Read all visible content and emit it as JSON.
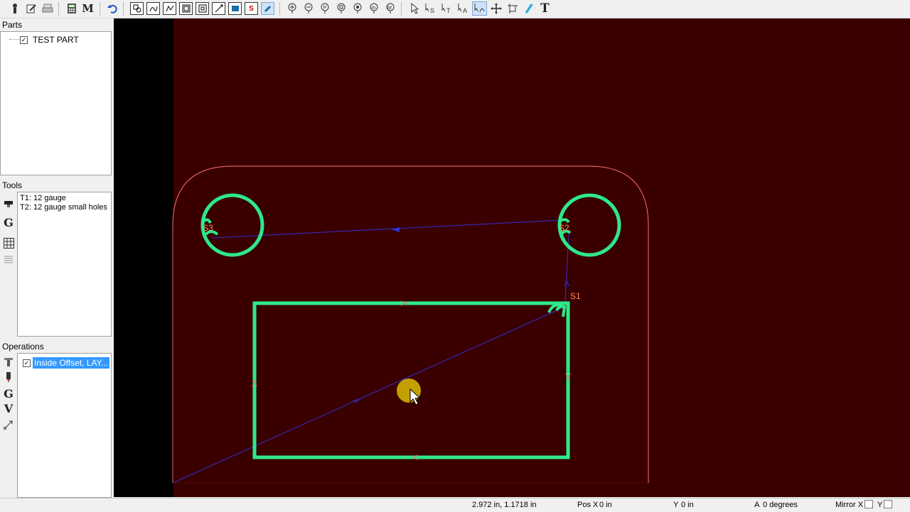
{
  "toolbar": {
    "icons": [
      "setup-icon",
      "edit-icon",
      "print-icon",
      "calculator-icon",
      "macro-icon",
      "undo-icon",
      "geometry-icon",
      "curve-icon",
      "path-icon",
      "offset-icon",
      "nested-offset-icon",
      "line-icon",
      "screen-icon",
      "s-icon",
      "brush-icon",
      "zoom-in-icon",
      "zoom-out-icon",
      "zoom-part-icon",
      "zoom-window-icon",
      "zoom-all-icon",
      "zoom-extents-icon",
      "select-icon",
      "select-s-icon",
      "select-t-icon",
      "select-a-icon",
      "select-curve-icon",
      "move-icon",
      "rotate-icon",
      "magnet-icon",
      "text-icon"
    ],
    "macro_label": "M",
    "text_label": "T",
    "s_label": "S"
  },
  "parts": {
    "title": "Parts",
    "items": [
      {
        "label": "TEST PART",
        "checked": true
      }
    ]
  },
  "tools": {
    "title": "Tools",
    "items": [
      "T1: 12 gauge",
      "T2: 12 gauge small holes"
    ],
    "strip_g": "G"
  },
  "operations": {
    "title": "Operations",
    "items": [
      {
        "label": "Inside Offset, LAY...",
        "checked": true,
        "selected": true
      }
    ],
    "strip_g": "G",
    "strip_v": "V"
  },
  "canvas": {
    "labels": {
      "s1": "S1",
      "s2": "S2",
      "s3": "S3"
    },
    "colors": {
      "background": "#3a0000",
      "part_outline": "#ff6a6a",
      "cut_path": "#2ee88a",
      "rapid": "#2c2ccc",
      "label": "#ff8a5a",
      "cursor_highlight": "#d4b000"
    }
  },
  "status": {
    "coords": "2.972 in, 1.1718 in",
    "pos_x_label": "Pos X",
    "pos_x_value": "0 in",
    "y_label": "Y",
    "y_value": "0 in",
    "angle_label": "A",
    "angle_value": "0 degrees",
    "mirror_x_label": "Mirror X",
    "mirror_y_label": "Y"
  }
}
